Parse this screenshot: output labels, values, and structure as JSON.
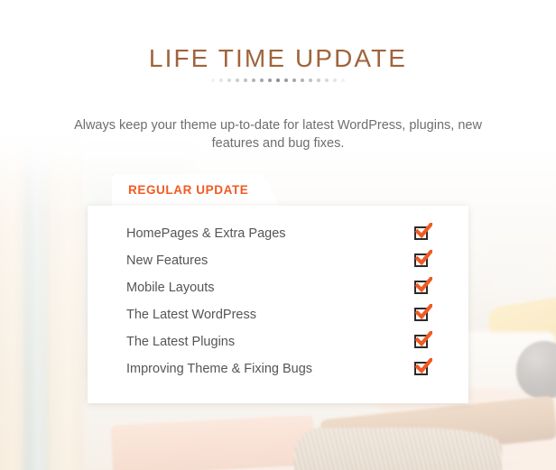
{
  "header": {
    "title": "LIFE TIME UPDATE",
    "subtitle": "Always keep your theme up-to-date for latest WordPress, plugins, new features and bug fixes.",
    "divider": {
      "icon": "dot-divider-icon",
      "dot_count": 17
    }
  },
  "panel": {
    "tab_label": "REGULAR UPDATE",
    "items": [
      {
        "label": "HomePages & Extra Pages",
        "checked": true,
        "icon": "checked-checkbox-icon"
      },
      {
        "label": "New Features",
        "checked": true,
        "icon": "checked-checkbox-icon"
      },
      {
        "label": "Mobile Layouts",
        "checked": true,
        "icon": "checked-checkbox-icon"
      },
      {
        "label": "The Latest WordPress",
        "checked": true,
        "icon": "checked-checkbox-icon"
      },
      {
        "label": "The Latest Plugins",
        "checked": true,
        "icon": "checked-checkbox-icon"
      },
      {
        "label": "Improving Theme & Fixing Bugs",
        "checked": true,
        "icon": "checked-checkbox-icon"
      }
    ]
  },
  "colors": {
    "title": "#a0643c",
    "accent_orange": "#f15a22",
    "subtitle_text": "#6e6e6e",
    "item_text": "#555555",
    "checkbox_border": "#2b2b2b",
    "panel_background": "#ffffff"
  },
  "background": {
    "scene": "blurred-living-room-photo",
    "elements": [
      "window-frame",
      "sofa",
      "yellow-pillow",
      "dark-vase",
      "wooden-table",
      "fur-throw"
    ]
  }
}
